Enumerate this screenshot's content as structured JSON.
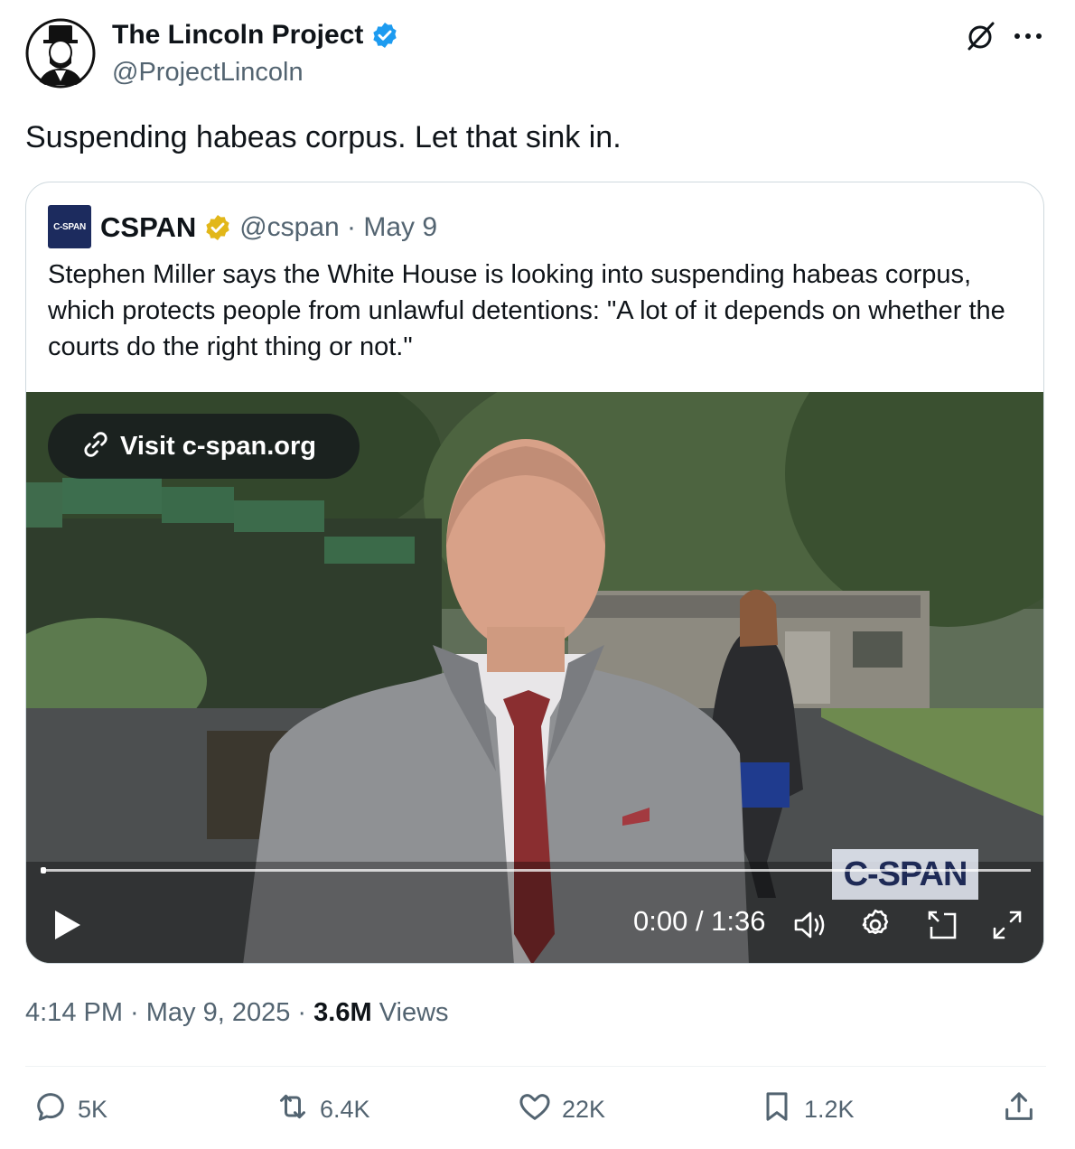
{
  "author": {
    "name": "The Lincoln Project",
    "handle": "@ProjectLincoln",
    "verified_color": "#1d9bf0"
  },
  "tweet": {
    "text": "Suspending habeas corpus. Let that sink in."
  },
  "quoted": {
    "logo_text": "C-SPAN",
    "name": "CSPAN",
    "verified_color": "#e2b719",
    "handle_date": "@cspan · May 9",
    "text": "Stephen Miller says the White House is looking into suspending habeas corpus, which protects people from unlawful detentions: \"A lot of it depends on whether the courts do the right thing or not.\""
  },
  "video": {
    "visit_label": "Visit c-span.org",
    "bug_text": "C-SPAN",
    "time": "0:00 / 1:36",
    "progress": 0
  },
  "meta": {
    "timestamp": "4:14 PM · May 9, 2025 · ",
    "views_count": "3.6M",
    "views_label": " Views"
  },
  "actions": {
    "replies": "5K",
    "reposts": "6.4K",
    "likes": "22K",
    "bookmarks": "1.2K"
  },
  "icons": [
    "verified-icon",
    "grok-icon",
    "more-icon",
    "link-icon",
    "play-icon",
    "volume-icon",
    "settings-icon",
    "pip-icon",
    "fullscreen-icon",
    "reply-icon",
    "repost-icon",
    "like-icon",
    "bookmark-icon",
    "share-icon"
  ]
}
